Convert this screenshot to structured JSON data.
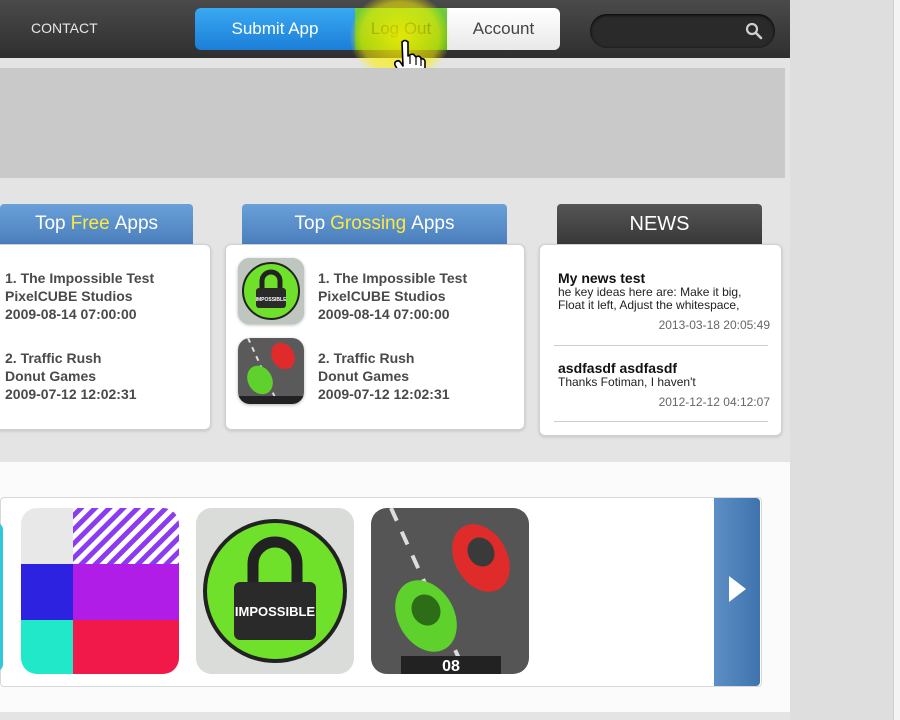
{
  "nav": {
    "contact": "CONTACT",
    "submit_app": "Submit App",
    "log_out": "Log Out",
    "account": "Account",
    "search_placeholder": ""
  },
  "sections": {
    "top_free": {
      "prefix": "Top ",
      "highlight": "Free",
      "suffix": " Apps"
    },
    "top_grossing": {
      "prefix": "Top ",
      "highlight": "Grossing",
      "suffix": " Apps"
    },
    "news": {
      "title": "NEWS"
    }
  },
  "top_free_apps": [
    {
      "line1": "1. The Impossible Test",
      "line2": "PixelCUBE Studios",
      "line3": "2009-08-14 07:00:00"
    },
    {
      "line1": "2. Traffic Rush",
      "line2": "Donut Games",
      "line3": "2009-07-12 12:02:31"
    }
  ],
  "top_grossing_apps": [
    {
      "line1": "1. The Impossible Test",
      "line2": "PixelCUBE Studios",
      "line3": "2009-08-14 07:00:00",
      "icon": "impossible-test-icon"
    },
    {
      "line1": "2. Traffic Rush",
      "line2": "Donut Games",
      "line3": "2009-07-12 12:02:31",
      "icon": "traffic-rush-icon"
    }
  ],
  "news": [
    {
      "title": "My news test",
      "body": "he key ideas here are: Make it big, Float it left, Adjust the whitespace,",
      "date": "2013-03-18 20:05:49"
    },
    {
      "title": "asdfasdf asdfasdf",
      "body": "Thanks Fotiman, I haven't",
      "date": "2012-12-12 04:12:07"
    }
  ],
  "carousel": {
    "impossible_label": "IMPOSSIBLE",
    "traffic_score": "08"
  },
  "colors": {
    "submit_blue": "#1b7fd8",
    "logout_green": "#4caf22",
    "header_blue": "#4a7fbd",
    "highlight_yellow": "#ffe83c"
  }
}
